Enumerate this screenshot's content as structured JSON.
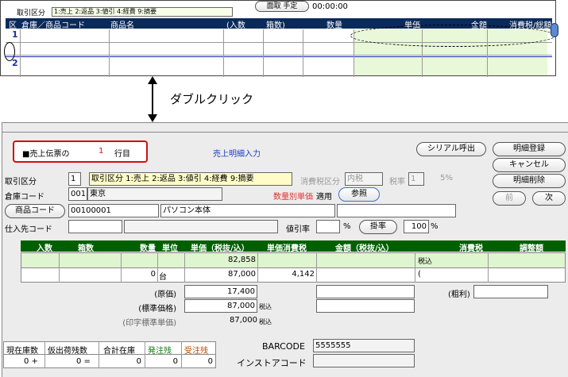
{
  "top": {
    "kubun_label": "取引区分",
    "kubun_hint": "1:売上 2:返品 3:値引 4:経費 9:摘要",
    "menu_button": "面取 手定",
    "time": "00:00:00",
    "headers": [
      "区",
      "倉庫／商品コード",
      "商品名",
      "(入数",
      "箱数)",
      "数量",
      "単価",
      "金額",
      "消費税/総額"
    ],
    "row1": "1",
    "row2": "2"
  },
  "annotation": {
    "text": "ダブルクリック"
  },
  "panel": {
    "slip_prefix": "■売上伝票の",
    "slip_no": "1",
    "slip_suffix": "行目",
    "title": "売上明細入力",
    "serial_btn": "シリアル呼出",
    "register_btn": "明細登録",
    "cancel_btn": "キャンセル",
    "delete_btn": "明細削除",
    "prev_btn": "前",
    "next_btn": "次",
    "kubun_label": "取引区分",
    "kubun_value": "1",
    "kubun_hint": "取引区分 1:売上 2:返品 3:値引 4:経費 9:摘要",
    "tax_class_label": "消費税区分",
    "tax_class_value": "内税",
    "tax_rate_label": "税率",
    "tax_rate_value": "1",
    "tax_rate_unit": "5%",
    "warehouse_label": "倉庫コード",
    "warehouse_code": "001",
    "warehouse_name": "東京",
    "qty_price_label": "数量別単価",
    "apply_label": "適用",
    "ref_btn": "参照",
    "product_btn": "商品コード",
    "product_code": "00100001",
    "product_name": "パソコン本体",
    "supplier_label": "仕入先コード",
    "discount_label": "値引率",
    "percent": "%",
    "rate_btn": "掛率",
    "rate_value": "100",
    "grid_headers": [
      "入数",
      "箱数",
      "数量",
      "単位",
      "単価（税抜/込）",
      "単価消費税",
      "金額（税抜/込）",
      "消費税",
      "調整額"
    ],
    "row_a_price": "82,858",
    "row_a_tax": "税込",
    "row_b_qty": "0",
    "row_b_unit": "台",
    "row_b_price": "87,000",
    "row_b_unit_tax": "4,142",
    "row_b_paren": "(",
    "cost_label": "(原価)",
    "cost_value": "17,400",
    "gross_label": "(粗利)",
    "std_label": "(標準価格)",
    "std_value": "87,000",
    "std_tax": "税込",
    "print_std_label": "(印字標準単価)",
    "print_std_value": "87,000",
    "print_std_tax": "税込",
    "stock_headers": [
      "現在庫数",
      "仮出荷残数",
      "合計在庫",
      "発注残",
      "受注残"
    ],
    "stock_values": [
      "0 +",
      "0 =",
      "0",
      "0",
      "0"
    ],
    "barcode_label": "BARCODE",
    "barcode_value": "5555555",
    "instore_label": "インストアコード"
  }
}
